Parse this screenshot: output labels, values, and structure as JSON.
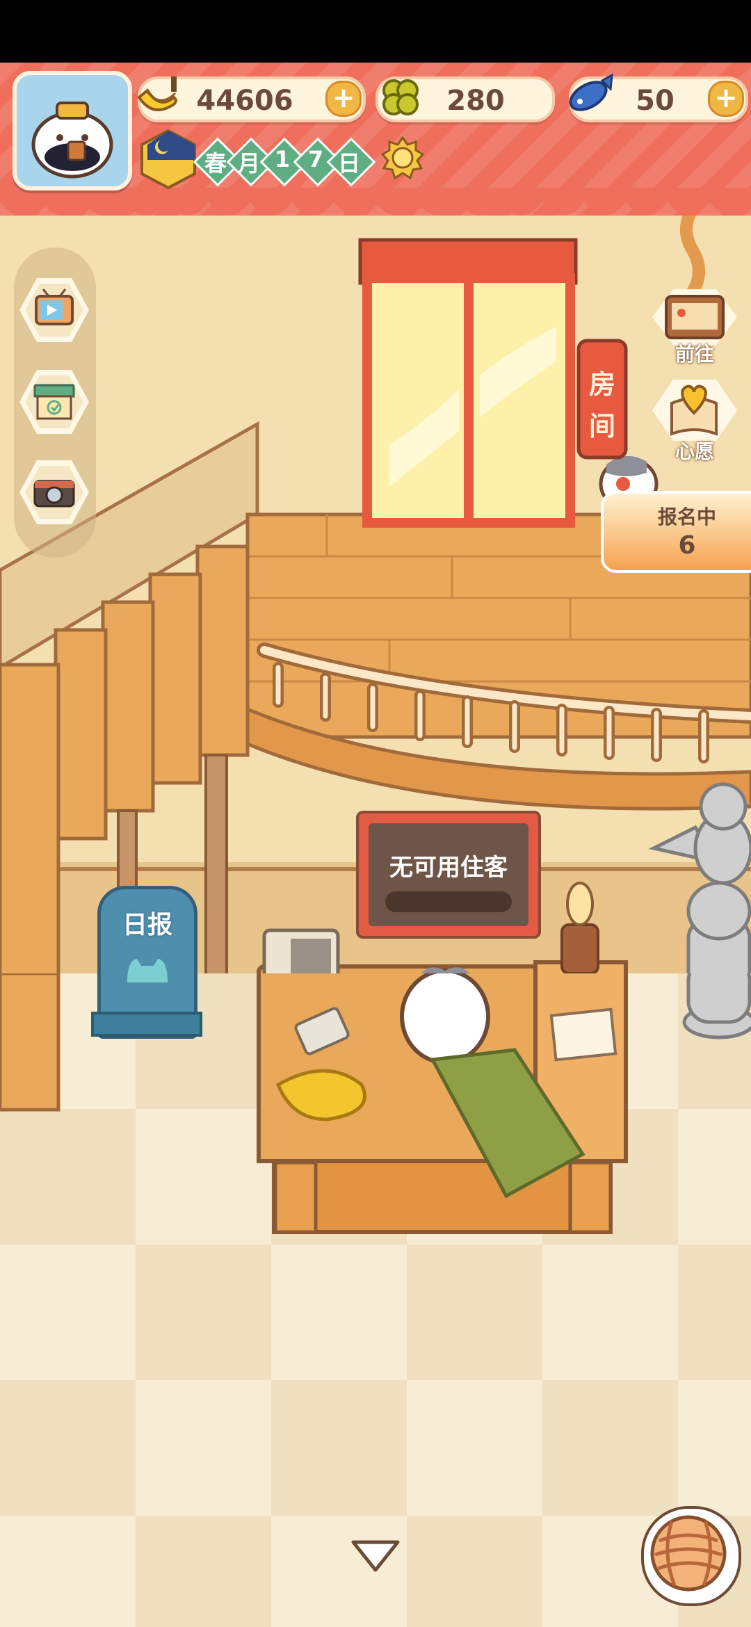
{
  "currencies": {
    "bananas": {
      "amount": "44606",
      "icon": "banana-icon",
      "has_plus": true
    },
    "clovers": {
      "amount": "280",
      "icon": "clover-icon",
      "has_plus": false
    },
    "fish": {
      "amount": "50",
      "icon": "fish-icon",
      "has_plus": true
    }
  },
  "date": {
    "season": "春",
    "month_label": "月",
    "day_digit_1": "1",
    "day_digit_2": "7",
    "day_label": "日",
    "weather_icon": "sun-icon",
    "time_icon": "moon-clock-icon"
  },
  "left_buttons": [
    {
      "icon": "tv-icon"
    },
    {
      "icon": "shop-icon"
    },
    {
      "icon": "camera-icon"
    }
  ],
  "right_buttons": {
    "go": {
      "label": "前往",
      "icon": "notice-board-icon"
    },
    "wish": {
      "label": "心愿",
      "icon": "heart-book-icon"
    }
  },
  "room_sign": {
    "line1": "房",
    "line2": "间"
  },
  "registration": {
    "label": "报名中",
    "count": "6"
  },
  "monitor": {
    "text": "无可用住客"
  },
  "newspaper": {
    "label": "日报"
  },
  "colors": {
    "banner": "#ef6f5c",
    "wood": "#e9a95a",
    "floor": "#f7ecd4",
    "accent_green": "#5fae83",
    "sign_red": "#e35b45"
  }
}
